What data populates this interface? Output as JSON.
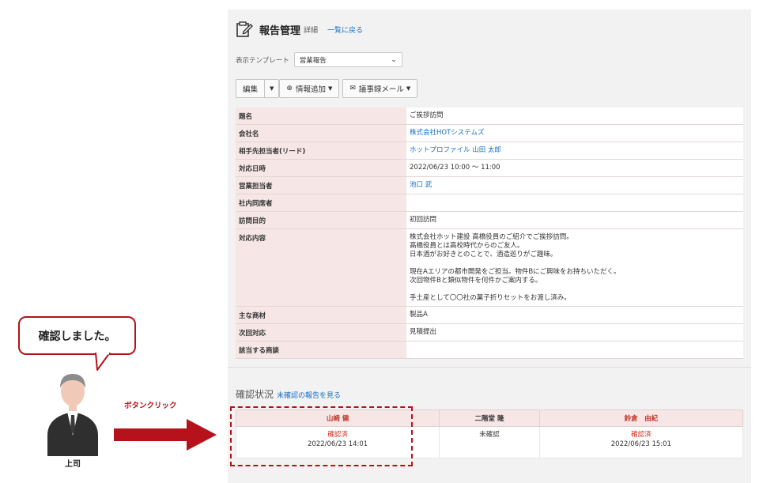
{
  "header": {
    "title": "報告管理",
    "subtitle": "詳細",
    "back_link": "一覧に戻る"
  },
  "template": {
    "label": "表示テンプレート",
    "selected": "営業報告"
  },
  "toolbar": {
    "edit_label": "編集",
    "add_info_label": "情報追加",
    "minutes_mail_label": "議事録メール"
  },
  "details": [
    {
      "key": "題名",
      "value": [
        "ご挨拶訪問"
      ],
      "link": false
    },
    {
      "key": "会社名",
      "value": [
        "株式会社HOTシステムズ"
      ],
      "link": true
    },
    {
      "key": "相手先担当者(リード)",
      "value": [
        "ホットプロファイル 山田 太郎"
      ],
      "link": true
    },
    {
      "key": "対応日時",
      "value": [
        "2022/06/23 10:00 ～ 11:00"
      ],
      "link": false
    },
    {
      "key": "営業担当者",
      "value": [
        "池口 武"
      ],
      "link": true
    },
    {
      "key": "社内同席者",
      "value": [
        ""
      ],
      "link": false
    },
    {
      "key": "訪問目的",
      "value": [
        "初回訪問"
      ],
      "link": false
    },
    {
      "key": "対応内容",
      "value": [
        "株式会社ホット建設 高橋役員のご紹介でご挨拶訪問。",
        "高橋役員とは高校時代からのご友人。",
        "日本酒がお好きとのことで、酒造巡りがご趣味。",
        "",
        "現在Aエリアの都市開発をご担当。物件Bにご興味をお持ちいただく。",
        "次回物件Bと類似物件を何件かご案内する。",
        "",
        "手土産として〇〇社の菓子折りセットをお渡し済み。"
      ],
      "link": false
    },
    {
      "key": "主な商材",
      "value": [
        "製品A"
      ],
      "link": false
    },
    {
      "key": "次回対応",
      "value": [
        "見積提出"
      ],
      "link": false
    },
    {
      "key": "該当する商談",
      "value": [
        ""
      ],
      "link": false
    }
  ],
  "confirmation": {
    "title": "確認状況",
    "link": "未確認の報告を見る",
    "columns": [
      {
        "name": "山崎 健",
        "status": "確認済",
        "time": "2022/06/23 14:01",
        "confirmed": true
      },
      {
        "name": "二階堂 隆",
        "status": "未確認",
        "time": "",
        "confirmed": false
      },
      {
        "name": "鈴倉　由紀",
        "status": "確認済",
        "time": "2022/06/23 15:01",
        "confirmed": true
      }
    ]
  },
  "illustration": {
    "bubble_text": "確認しました。",
    "person_label": "上司",
    "click_label": "ボタンクリック"
  },
  "colors": {
    "accent_red": "#b5121b",
    "link_blue": "#1a6fc4",
    "key_bg": "#f6e6e6",
    "confirmed_red": "#d4281b"
  }
}
